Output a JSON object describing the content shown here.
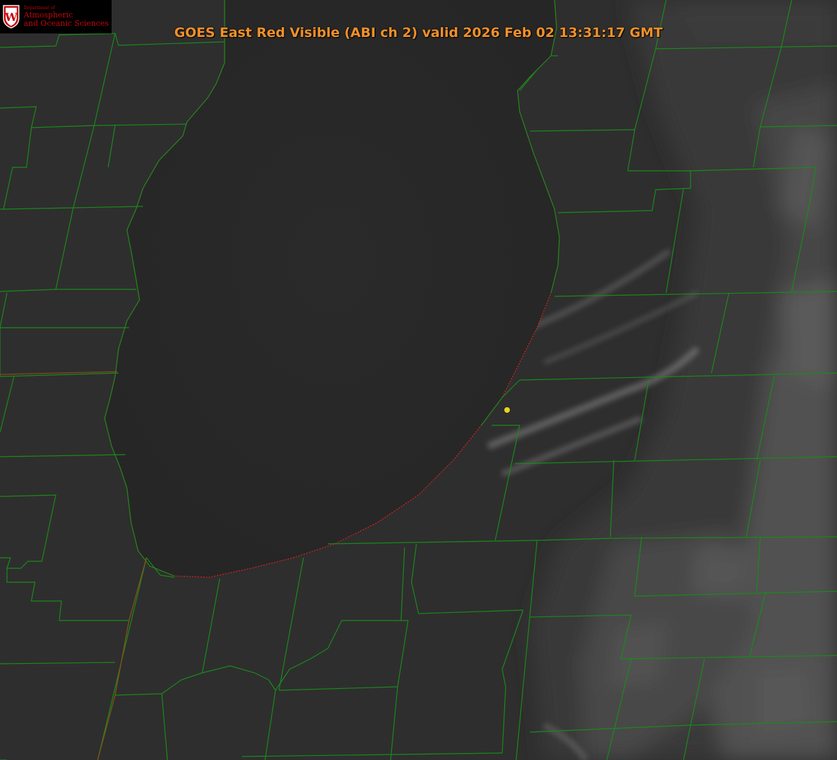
{
  "title": "GOES East Red Visible (ABI ch 2) valid 2026 Feb 02 13:31:17 GMT",
  "logo": {
    "dept_label": "Department of",
    "line1": "Atmospheric",
    "line2": "and Oceanic Sciences",
    "crest_letter": "W",
    "crest_icon": "university-crest-icon"
  },
  "colors": {
    "background": "#2f2f2f",
    "lake": "#282828",
    "county_lines": "#1a8a1a",
    "shoreline": "#e02020",
    "title_text": "#f0902a",
    "marker": "#e6d619",
    "logo_red": "#c5050c"
  },
  "icons": {
    "location_marker": "location-dot-icon"
  }
}
